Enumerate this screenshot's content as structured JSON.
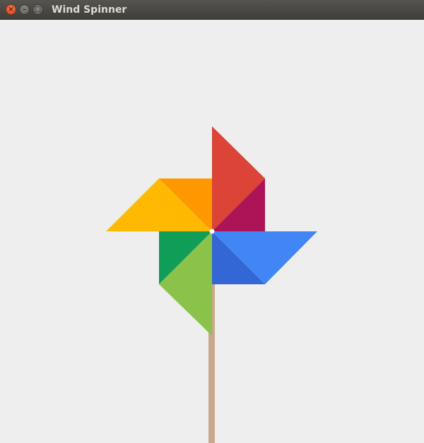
{
  "window": {
    "title": "Wind Spinner",
    "controls": {
      "close_icon": "close-icon",
      "minimize_icon": "minimize-icon",
      "maximize_icon": "maximize-icon"
    }
  },
  "canvas": {
    "background": "#eeeeee"
  },
  "pinwheel": {
    "stick_color": "#c9a88c",
    "pin_color": "#ffffff",
    "blades": [
      {
        "name": "red-blade",
        "outer_color": "#db4437",
        "inner_color": "#ad1457"
      },
      {
        "name": "blue-blade",
        "outer_color": "#4285f4",
        "inner_color": "#3367d6"
      },
      {
        "name": "green-blade",
        "outer_color": "#8bc34a",
        "inner_color": "#0f9d58"
      },
      {
        "name": "yellow-blade",
        "outer_color": "#ffb900",
        "inner_color": "#ff9800"
      }
    ]
  }
}
